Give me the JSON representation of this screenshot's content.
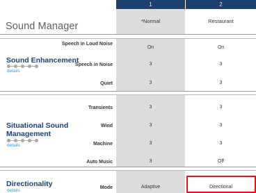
{
  "columns": [
    "1",
    "2"
  ],
  "header": {
    "title": "Sound Manager",
    "programs": [
      "*Normal",
      "Restaurant"
    ]
  },
  "sections": [
    {
      "title": "Sound Enhancement",
      "details": "details",
      "rows": [
        {
          "label": "Speech in Loud Noise",
          "values": [
            "On",
            "On"
          ]
        },
        {
          "label": "Speech in Noise",
          "values": [
            "3",
            "3"
          ]
        },
        {
          "label": "Quiet",
          "values": [
            "3",
            "3"
          ]
        }
      ]
    },
    {
      "title": "Situational Sound Management",
      "details": "details",
      "rows": [
        {
          "label": "Transients",
          "values": [
            "3",
            "3"
          ]
        },
        {
          "label": "Wind",
          "values": [
            "3",
            "3"
          ]
        },
        {
          "label": "Machine",
          "values": [
            "3",
            "3"
          ]
        },
        {
          "label": "Auto Music",
          "values": [
            "3",
            "Off"
          ]
        }
      ]
    },
    {
      "title": "Directionality",
      "details": "details",
      "rows": [
        {
          "label": "Mode",
          "values": [
            "Adaptive",
            "Directional"
          ]
        }
      ]
    }
  ],
  "colors": {
    "header_bg": "#1d3f6e",
    "section_title": "#1d3f6e",
    "link": "#3a9bd6",
    "gray_column": "#dcdcdc",
    "highlight": "#e0141b"
  }
}
